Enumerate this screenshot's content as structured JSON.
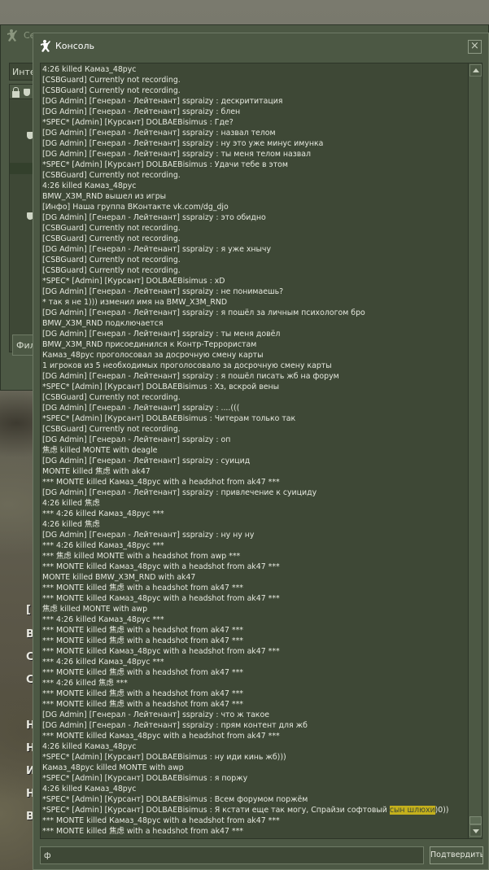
{
  "servers_window": {
    "title": "Серверы",
    "tab_label": "Интернет",
    "filter_label": "Фильтры"
  },
  "background_text": [
    "[",
    "В",
    "С",
    "С",
    "Н",
    "Н",
    "И",
    "Н",
    "В"
  ],
  "console": {
    "title": "Консоль",
    "close_glyph": "×",
    "input_value": "ф",
    "submit_label": "Подтвердить",
    "highlight_text": "сын шлюхи",
    "lines": [
      "4:26 killed Камаз_48рус",
      "[CSBGuard] Currently not recording.",
      "[CSBGuard] Currently not recording.",
      "[DG Admin] [Генерал - Лейтенант] sspraizy : дескрититация",
      "[DG Admin] [Генерал - Лейтенант] sspraizy : блен",
      "*SPEC* [Admin] [Курсант] DOLBAEBisimus : Где?",
      "[DG Admin] [Генерал - Лейтенант] sspraizy : назвал телом",
      "[DG Admin] [Генерал - Лейтенант] sspraizy : ну это уже минус имунка",
      "[DG Admin] [Генерал - Лейтенант] sspraizy : ты меня телом назвал",
      "*SPEC* [Admin] [Курсант] DOLBAEBisimus : Удачи тебе в этом",
      "[CSBGuard] Currently not recording.",
      "4:26 killed Камаз_48рус",
      "BMW_X3M_RND вышел из игры",
      "[Инфо] Наша группа ВКонтакте vk.com/dg_djo",
      "[DG Admin] [Генерал - Лейтенант] sspraizy : это обидно",
      "[CSBGuard] Currently not recording.",
      "[CSBGuard] Currently not recording.",
      "[DG Admin] [Генерал - Лейтенант] sspraizy : я уже хнычу",
      "[CSBGuard] Currently not recording.",
      "[CSBGuard] Currently not recording.",
      "*SPEC* [Admin] [Курсант] DOLBAEBisimus : xD",
      "[DG Admin] [Генерал - Лейтенант] sspraizy : не понимаешь?",
      "* так я не 1))) изменил имя на BMW_X3M_RND",
      "[DG Admin] [Генерал - Лейтенант] sspraizy : я пошёл за личным психологом бро",
      "BMW_X3M_RND подключается",
      "[DG Admin] [Генерал - Лейтенант] sspraizy : ты меня довёл",
      "BMW_X3M_RND присоединился к Контр-Террористам",
      "Камаз_48рус проголосовал за досрочную смену карты",
      "1 игроков из 5 необходимых проголосовало за досрочную смену карты",
      "[DG Admin] [Генерал - Лейтенант] sspraizy : я пошёл писать жб на форум",
      "*SPEC* [Admin] [Курсант] DOLBAEBisimus : Хз, вскрой вены",
      "[CSBGuard] Currently not recording.",
      "[DG Admin] [Генерал - Лейтенант] sspraizy : ....(((",
      "*SPEC* [Admin] [Курсант] DOLBAEBisimus : Читерам только так",
      "[CSBGuard] Currently not recording.",
      "[DG Admin] [Генерал - Лейтенант] sspraizy : оп",
      "焦虑 killed MONTE with deagle",
      "[DG Admin] [Генерал - Лейтенант] sspraizy : суицид",
      "MONTE killed 焦虑 with ak47",
      "*** MONTE killed Камаз_48рус with a headshot from ak47 ***",
      "[DG Admin] [Генерал - Лейтенант] sspraizy : привлечение к суициду",
      "4:26 killed 焦虑",
      "*** 4:26 killed Камаз_48рус ***",
      "4:26 killed 焦虑",
      "[DG Admin] [Генерал - Лейтенант] sspraizy : ну ну ну",
      "*** 4:26 killed Камаз_48рус ***",
      "*** 焦虑 killed MONTE with a headshot from awp ***",
      "*** MONTE killed Камаз_48рус with a headshot from ak47 ***",
      "MONTE killed BMW_X3M_RND with ak47",
      "*** MONTE killed 焦虑 with a headshot from ak47 ***",
      "*** MONTE killed Камаз_48рус with a headshot from ak47 ***",
      "焦虑 killed MONTE with awp",
      "*** 4:26 killed Камаз_48рус ***",
      "*** MONTE killed 焦虑 with a headshot from ak47 ***",
      "*** MONTE killed 焦虑 with a headshot from ak47 ***",
      "*** MONTE killed Камаз_48рус with a headshot from ak47 ***",
      "*** 4:26 killed Камаз_48рус ***",
      "*** MONTE killed 焦虑 with a headshot from ak47 ***",
      "*** 4:26 killed 焦虑 ***",
      "*** MONTE killed 焦虑 with a headshot from ak47 ***",
      "*** MONTE killed 焦虑 with a headshot from ak47 ***",
      "[DG Admin] [Генерал - Лейтенант] sspraizy : что ж такое",
      "[DG Admin] [Генерал - Лейтенант] sspraizy : прям контент для жб",
      "*** MONTE killed Камаз_48рус with a headshot from ak47 ***",
      "4:26 killed Камаз_48рус",
      "*SPEC* [Admin] [Курсант] DOLBAEBisimus : ну иди кинь жб)))",
      "Камаз_48рус killed MONTE with awp",
      "*SPEC* [Admin] [Курсант] DOLBAEBisimus : я поржу",
      "4:26 killed Камаз_48рус",
      "*SPEC* [Admin] [Курсант] DOLBAEBisimus : Всем форумом поржём",
      "*SPEC* [Admin] [Курсант] DOLBAEBisimus : Я кстати еще так могу, Спрайзи софтовый сын шлюхи)0))",
      "*** MONTE killed Камаз_48рус with a headshot from ak47 ***",
      "*** MONTE killed 焦虑 with a headshot from ak47 ***"
    ]
  },
  "colors": {
    "window_bg": "#4c5844",
    "panel_bg": "#3e4836",
    "text": "#e6e9df",
    "highlight": "#c4b01c"
  }
}
